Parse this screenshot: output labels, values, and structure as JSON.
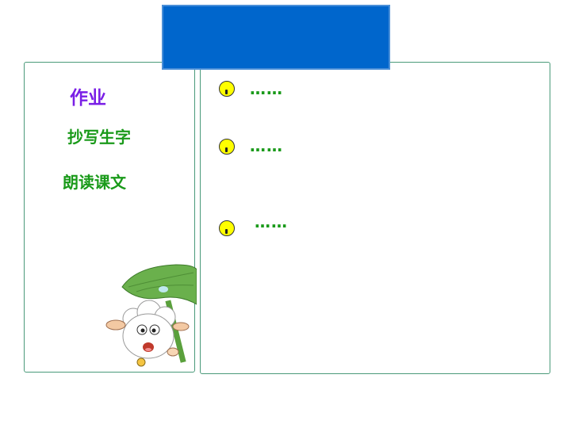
{
  "slide": {
    "heading": "作业",
    "tasks": [
      "抄写生字",
      "朗读课文"
    ],
    "bullet_items": [
      "……",
      "……",
      "……"
    ]
  },
  "colors": {
    "title_box": "#0066cc",
    "heading": "#7a1fe6",
    "task_text": "#1a9a1a",
    "bullet_fill": "#ffff00",
    "panel_border": "#4a9a7a"
  },
  "icons": {
    "bullet": "yellow-circle-bullet-icon",
    "mascot": "sheep-with-lotus-leaf-illustration"
  }
}
